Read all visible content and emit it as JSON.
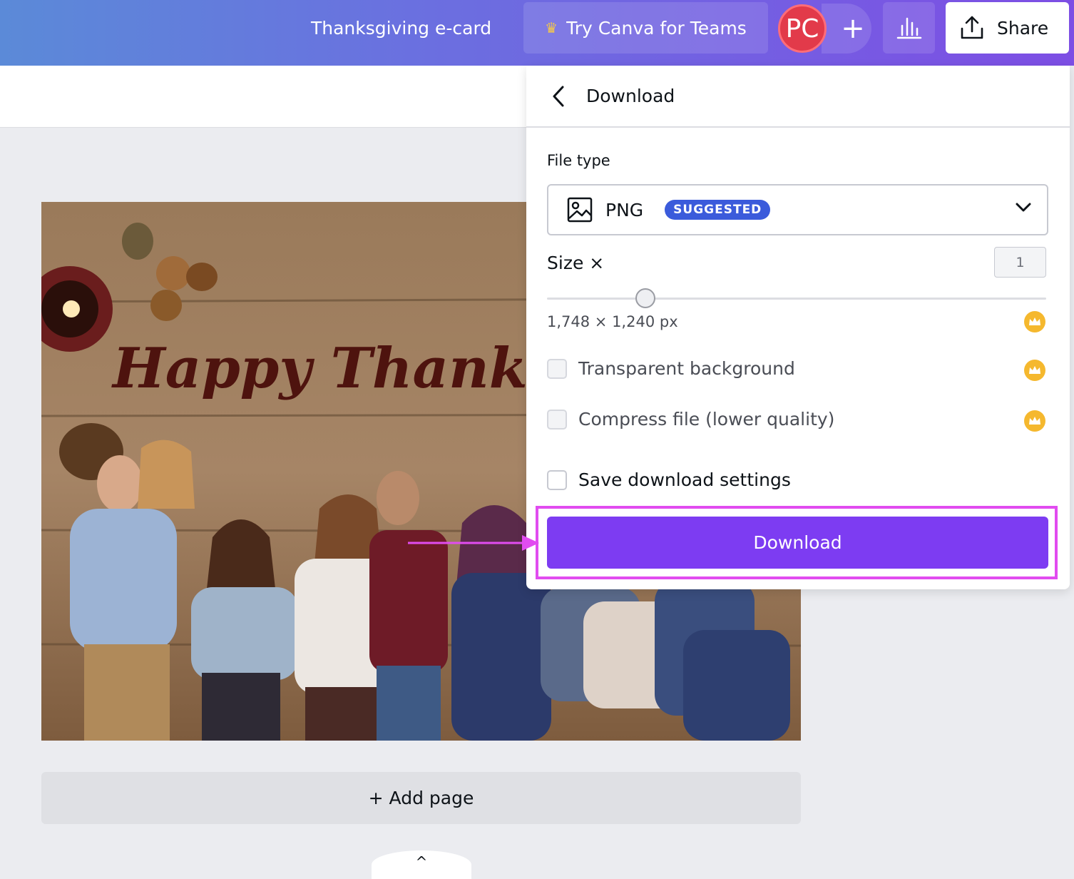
{
  "topbar": {
    "doc_title": "Thanksgiving e-card",
    "teams_label": "Try Canva for Teams",
    "avatar_initials": "PC",
    "invite_symbol": "+",
    "share_label": "Share"
  },
  "canvas": {
    "card_text": "Happy Thanksgiving",
    "add_page_label": "+ Add page",
    "collapse_symbol": "^"
  },
  "panel": {
    "title": "Download",
    "file_type_label": "File type",
    "file_type_value": "PNG",
    "suggested_badge": "SUGGESTED",
    "size_label": "Size ×",
    "size_value": "1",
    "size_level": 0.2,
    "dimensions": "1,748 × 1,240 px",
    "transparent_label": "Transparent background",
    "compress_label": "Compress file (lower quality)",
    "save_settings_label": "Save download settings",
    "download_label": "Download"
  },
  "colors": {
    "topbar_gradient": [
      "#5b8ad8",
      "#7d4ee4"
    ],
    "download_button": "#7d3cf2",
    "highlight": "#e14cf0",
    "badge": "#3b5bdb",
    "pro_crown": "#f5b82e"
  },
  "icons": [
    "crown-icon",
    "stats-icon",
    "share-upload-icon",
    "back-chevron-icon",
    "image-icon",
    "chevron-down-icon",
    "pro-crown-icon",
    "arrow-icon"
  ]
}
